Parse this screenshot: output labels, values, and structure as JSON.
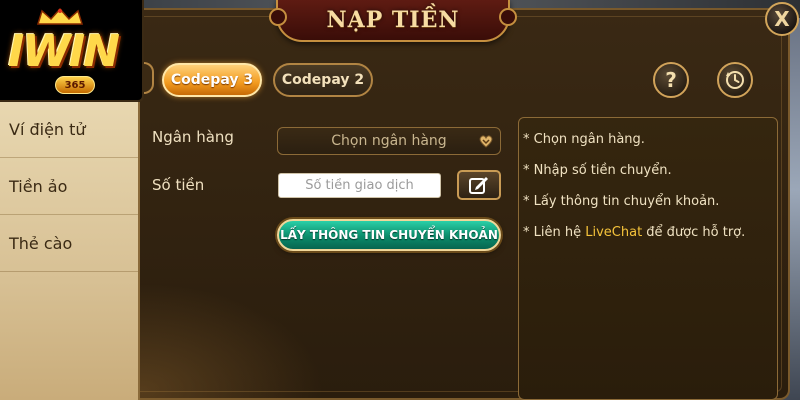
{
  "dialog": {
    "title": "NẠP TIỀN",
    "close_label": "X"
  },
  "logo": {
    "brand": "IWIN",
    "badge": "365"
  },
  "sidebar": {
    "items": [
      {
        "label": "Ví điện tử"
      },
      {
        "label": "Tiền ảo"
      },
      {
        "label": "Thẻ cào"
      }
    ]
  },
  "tabs": [
    {
      "label": "Codepay 3",
      "active": true
    },
    {
      "label": "Codepay 2",
      "active": false
    }
  ],
  "toolbar": {
    "help_label": "?"
  },
  "form": {
    "bank_label": "Ngân hàng",
    "bank_placeholder": "Chọn ngân hàng",
    "amount_label": "Số tiền",
    "amount_placeholder": "Số tiền giao dịch",
    "amount_value": "",
    "submit_label": "LẤY THÔNG TIN CHUYỂN KHOẢN"
  },
  "instructions": {
    "lines": [
      "* Chọn ngân hàng.",
      "* Nhập số tiền chuyển.",
      "* Lấy thông tin chuyển khoản."
    ],
    "contact_prefix": "* Liên hệ ",
    "contact_link": "LiveChat",
    "contact_suffix": " để được hỗ trợ."
  },
  "colors": {
    "accent_orange": "#f29a1e",
    "button_green": "#0b8c6a",
    "title_red": "#5e1b12",
    "gold_border": "#c58f3f",
    "livechat_yellow": "#f5c33b"
  },
  "icons": {
    "close": "close-icon",
    "help": "question-mark-icon",
    "history": "clock-history-icon",
    "dropdown": "heart-chevron-icon",
    "edit": "edit-pencil-icon"
  }
}
